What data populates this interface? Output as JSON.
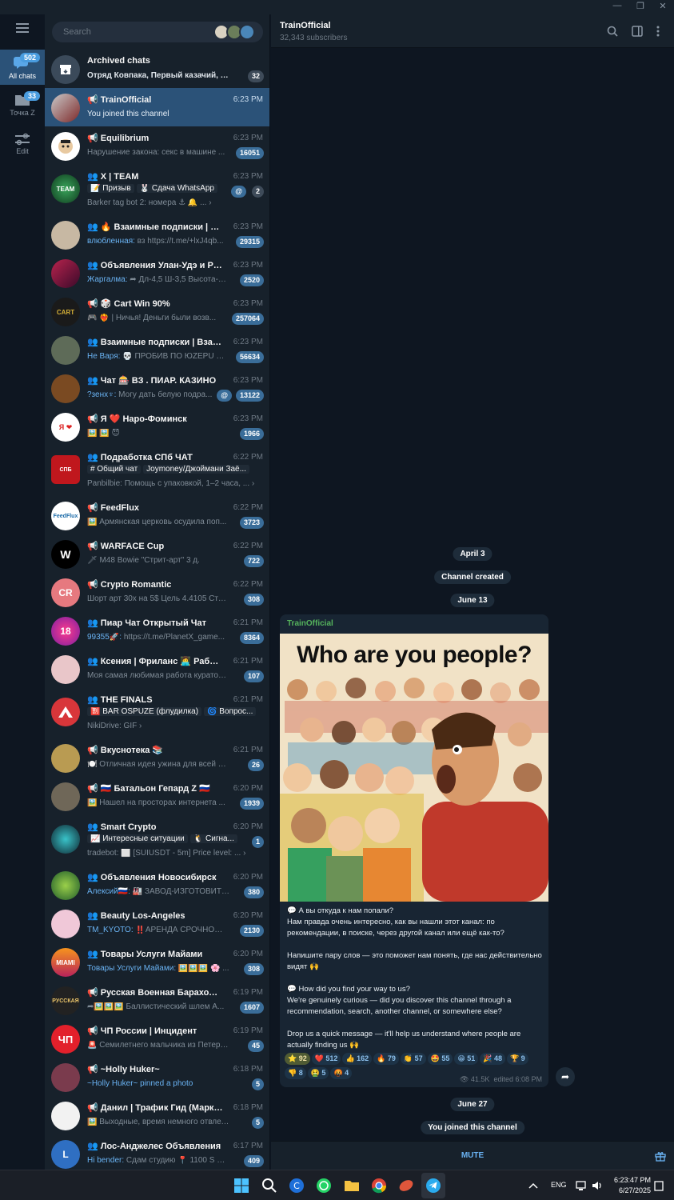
{
  "window": {
    "minimize_glyph": "—",
    "maximize_glyph": "❐",
    "close_glyph": "✕"
  },
  "folders": [
    {
      "label": "All chats",
      "count": "502",
      "icon": "chats-icon"
    },
    {
      "label": "Точка Z",
      "count": "33",
      "icon": "folder-icon"
    },
    {
      "label": "Edit",
      "icon": "edit-folders-icon"
    }
  ],
  "search": {
    "placeholder": "Search"
  },
  "archived": {
    "name": "Archived chats",
    "preview": "Отряд Ковпака, Первый казачий, М...",
    "count": "32"
  },
  "chats": [
    {
      "name": "📢 TrainOfficial",
      "time": "6:23 PM",
      "preview": "You joined this channel",
      "badge": ""
    },
    {
      "name": "📢 Equilibrium",
      "time": "6:23 PM",
      "preview": "Нарушение закона: секс в машине ...",
      "badge": "16051"
    },
    {
      "name": "👥 X | TEAM",
      "time": "6:23 PM",
      "topic1": "📝 Призыв",
      "topic2": "🐰 Сдача WhatsApp",
      "mention": "@",
      "badge": "2",
      "line2": "Barker tag bot 2: номера ⚓ 🔔 ... ›"
    },
    {
      "name": "👥 🔥 Взаимные подписки | PEA...",
      "time": "6:23 PM",
      "sender": "влюбленная:",
      "preview": " вз https://t.me/+lxJ4qb...",
      "badge": "29315"
    },
    {
      "name": "👥 Объявления Улан-Удэ и Районы",
      "time": "6:23 PM",
      "sender": "Жаргалма:",
      "preview": " ➦ Дл-4,5 Ш-3,5 Высота-2 8...",
      "badge": "2520"
    },
    {
      "name": "📢 🎲 Cart Win 90%",
      "time": "6:23 PM",
      "preview": "🎮 ❤️‍🔥 | Ничья! Деньги были возв...",
      "badge": "257064"
    },
    {
      "name": "👥 Взаимные подписки | Взаим...",
      "time": "6:23 PM",
      "sender": "Не Варя:",
      "preview": " 💀 ПРОБИВ ПО ЮZEPU @LIN...",
      "badge": "56634"
    },
    {
      "name": "👥 Чат 🎰 ВЗ . ПИАР. КАЗИНО",
      "time": "6:23 PM",
      "sender": "?зенх♆:",
      "preview": " Могу дать белую подра...",
      "mention": "@",
      "badge": "13122"
    },
    {
      "name": "📢 Я ❤️ Наро-Фоминск",
      "time": "6:23 PM",
      "preview": "🖼️ 🖼️ 😈",
      "badge": "1966"
    },
    {
      "name": "👥 Подработка СПб ЧАТ",
      "time": "6:22 PM",
      "topic1": "# Общий чат",
      "topic2": "Joymoney/Джоймани Заё...",
      "line2": "Panbilbie: Помощь с упаковкой, 1–2 часа, ... ›"
    },
    {
      "name": "📢 FeedFlux",
      "time": "6:22 PM",
      "preview": "🖼️ Армянская церковь осудила поп...",
      "badge": "3723"
    },
    {
      "name": "📢 WARFACE Cup",
      "time": "6:22 PM",
      "preview": "🗡 M48 Bowie \"Стрит-арт\" 3 д.",
      "badge": "722"
    },
    {
      "name": "📢 Crypto Romantic",
      "time": "6:22 PM",
      "preview": "Шорт арт 30х на 5$ Цель 4.4105 Стоп ...",
      "badge": "308",
      "initials": "CR"
    },
    {
      "name": "👥 Пиар Чат Открытый Чат",
      "time": "6:21 PM",
      "sender": "99355🚀:",
      "preview": " https://t.me/PlanetX_game...",
      "badge": "8364"
    },
    {
      "name": "👥 Ксения | Фриланс 👩‍💻 Работа о...",
      "time": "6:21 PM",
      "preview": "Моя самая любимая работа кураторо...",
      "badge": "107"
    },
    {
      "name": "👥 THE FINALS",
      "time": "6:21 PM",
      "topic1": "🈹 BAR OSPUZE (флудилка)",
      "topic2": "🌀 Вопрос...",
      "line2": "NikiDrive: GIF ›"
    },
    {
      "name": "📢 Вкуснотека 📚",
      "time": "6:21 PM",
      "preview": "🍽️ Отличная идея ужина для всей сем...",
      "badge": "26"
    },
    {
      "name": "📢 🇷🇺 Батальон Гепард Z 🇷🇺",
      "time": "6:20 PM",
      "preview": "🖼️ Нашел на просторах интернета ...",
      "badge": "1939"
    },
    {
      "name": "👥 Smart Crypto",
      "time": "6:20 PM",
      "topic1": "📈 Интересные ситуации",
      "topic2": "🐧 Сигна...",
      "badge": "1",
      "line2": "tradebot: ⬜ [SUIUSDT - 5m] Price level: ... ›"
    },
    {
      "name": "👥 Объявления Новосибирск",
      "time": "6:20 PM",
      "sender": "Алексий🇷🇺:",
      "preview": " 🏭 ЗАВОД-ИЗГОТОВИТЕ...",
      "badge": "380"
    },
    {
      "name": "👥 Beauty Los-Angeles",
      "time": "6:20 PM",
      "sender": "TM_KYOTO:",
      "preview": " ‼️АРЕНДА СРОЧНО‼️ ...",
      "badge": "2130"
    },
    {
      "name": "👥 Товары Услуги Майами",
      "time": "6:20 PM",
      "sender": "Товары Услуги Майами:",
      "preview": " 🖼️🖼️🖼️ 🌸 ...",
      "badge": "308"
    },
    {
      "name": "📢 Русская Военная Барахолка 🤙",
      "time": "6:19 PM",
      "preview": "➦🖼️🖼️🖼️ Баллистический шлем А...",
      "badge": "1607"
    },
    {
      "name": "📢 ЧП России | Инцидент",
      "time": "6:19 PM",
      "preview": "🚨 Семилетнего мальчика из Петербу...",
      "badge": "45"
    },
    {
      "name": "📢 ~Holly Huker~",
      "time": "6:18 PM",
      "preview": "~Holly Huker~ pinned a photo",
      "badge": "5"
    },
    {
      "name": "📢 Данил | Трафик Гид (Маркети...",
      "time": "6:18 PM",
      "preview": "🖼️ Выходные, время немного отвлечь...",
      "badge": "5"
    },
    {
      "name": "👥 Лос-Анджелес Объявления",
      "time": "6:17 PM",
      "sender": "Hi bender:",
      "preview": " Сдам студию 📍 1100 S Hill ...",
      "badge": "409"
    }
  ],
  "header": {
    "title": "TrainOfficial",
    "subtitle": "32,343 subscribers"
  },
  "service": {
    "date1": "April 3",
    "created": "Channel created",
    "date2": "June 13",
    "date3": "June 27",
    "joined": "You joined this channel"
  },
  "post": {
    "author": "TrainOfficial",
    "image_title": "Who are you people?",
    "p1": "💬 А вы откуда к нам попали?",
    "p2": "Нам правда очень интересно, как вы нашли этот канал: по рекомендации, в поиске, через другой канал или ещё как-то?",
    "p3": "Напишите пару слов — это поможет нам понять, где нас действительно видят 🙌",
    "p4": "💬 How did you find your way to us?",
    "p5": "We're genuinely curious — did you discover this channel through a recommendation, search, another channel, or somewhere else?",
    "p6": "Drop us a quick message — it'll help us understand where people are actually finding us 🙌",
    "reactions": [
      "⭐ 92",
      "❤️ 512",
      "👍 162",
      "🔥 79",
      "👏 57",
      "🤩 55",
      "😁 51",
      "🎉 48",
      "🏆 9",
      "👎 8",
      "🤮 5",
      "🤬 4"
    ],
    "views": "👁 41.5K",
    "edited": "edited 6:08 PM"
  },
  "bottom": {
    "mute": "MUTE"
  },
  "taskbar": {
    "lang": "ENG",
    "time": "6:23:47 PM",
    "date": "6/27/2025"
  },
  "colors": {
    "accent": "#2b5278",
    "link": "#6ab3f3",
    "background": "#0e1621",
    "panel": "#17212b"
  }
}
